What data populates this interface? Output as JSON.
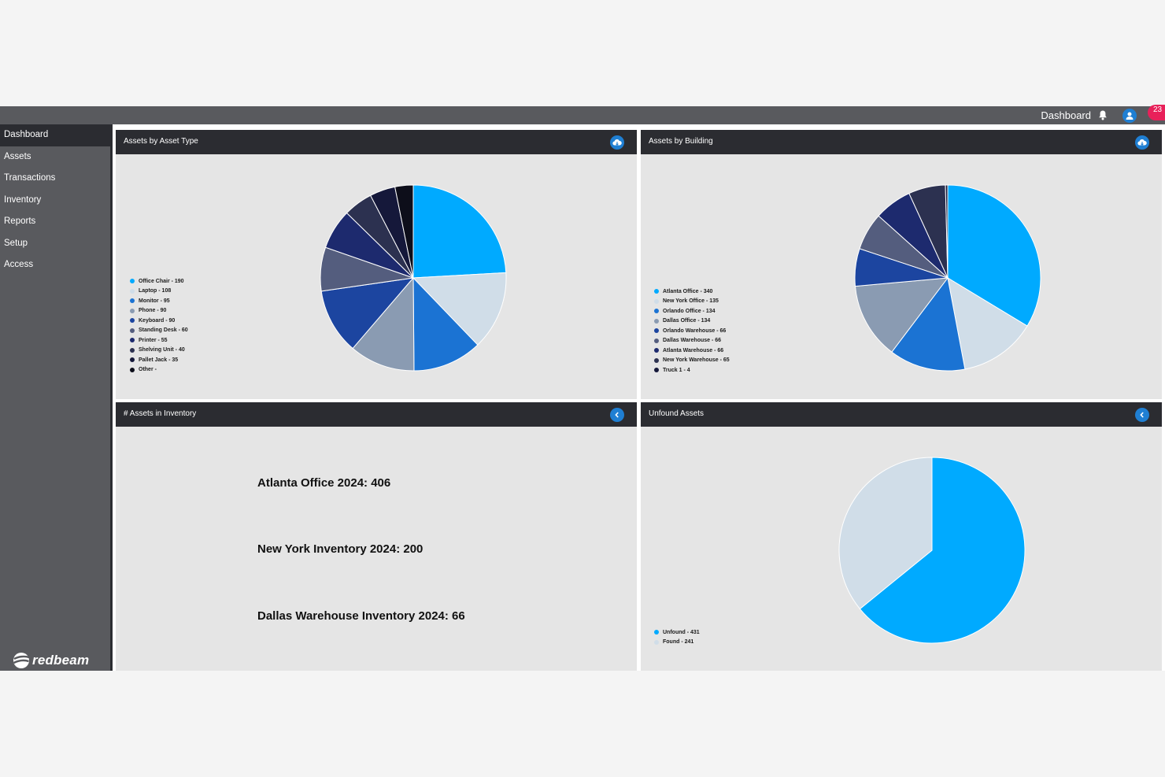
{
  "topbar": {
    "title": "Dashboard",
    "notification_count": "23"
  },
  "sidebar": {
    "items": [
      {
        "label": "Dashboard"
      },
      {
        "label": "Assets"
      },
      {
        "label": "Transactions"
      },
      {
        "label": "Inventory"
      },
      {
        "label": "Reports"
      },
      {
        "label": "Setup"
      },
      {
        "label": "Access"
      }
    ],
    "active": "Dashboard",
    "logo_text": "redbeam"
  },
  "panels": {
    "asset_type": {
      "title": "Assets by Asset Type",
      "button_icon": "cloud-download-icon"
    },
    "building": {
      "title": "Assets by Building",
      "button_icon": "cloud-download-icon"
    },
    "inventory": {
      "title": "# Assets in Inventory",
      "button_icon": "chevron-left-icon",
      "lines": [
        "Atlanta Office 2024: 406",
        "New York Inventory 2024: 200",
        "Dallas Warehouse Inventory 2024: 66"
      ]
    },
    "unfound": {
      "title": "Unfound Assets",
      "button_icon": "chevron-left-icon"
    }
  },
  "chart_data": [
    {
      "type": "pie",
      "legend_placement": "left",
      "labels": [
        "Office Chair - 190",
        "Laptop - 108",
        "Monitor - 95",
        "Phone - 90",
        "Keyboard - 90",
        "Standing Desk - 60",
        "Printer - 55",
        "Shelving Unit - 40",
        "Pallet Jack - 35",
        "Other -"
      ],
      "categories": [
        "Office Chair",
        "Laptop",
        "Monitor",
        "Phone",
        "Keyboard",
        "Standing Desk",
        "Printer",
        "Shelving Unit",
        "Pallet Jack",
        "Other"
      ],
      "values": [
        190,
        108,
        95,
        90,
        90,
        60,
        55,
        40,
        35,
        25
      ],
      "colors": [
        "#00aaff",
        "#d0dde8",
        "#1b73d3",
        "#8a9bb2",
        "#1c45a0",
        "#545d7e",
        "#1d2a6e",
        "#2c3150",
        "#15183a",
        "#0d0e1a"
      ]
    },
    {
      "type": "pie",
      "legend_placement": "left",
      "labels": [
        "Atlanta Office - 340",
        "New York Office - 135",
        "Orlando Office - 134",
        "Dallas Office - 134",
        "Orlando Warehouse - 66",
        "Dallas Warehouse - 66",
        "Atlanta Warehouse - 66",
        "New York Warehouse - 65",
        "Truck 1 - 4"
      ],
      "categories": [
        "Atlanta Office",
        "New York Office",
        "Orlando Office",
        "Dallas Office",
        "Orlando Warehouse",
        "Dallas Warehouse",
        "Atlanta Warehouse",
        "New York Warehouse",
        "Truck 1"
      ],
      "values": [
        340,
        135,
        134,
        134,
        66,
        66,
        66,
        65,
        4
      ],
      "colors": [
        "#00aaff",
        "#d0dde8",
        "#1b73d3",
        "#8a9bb2",
        "#1c45a0",
        "#545d7e",
        "#1d2a6e",
        "#2c3150",
        "#15183a"
      ]
    },
    {
      "type": "pie",
      "legend_placement": "bottom-left",
      "labels": [
        "Unfound - 431",
        "Found - 241"
      ],
      "categories": [
        "Unfound",
        "Found"
      ],
      "values": [
        431,
        241
      ],
      "colors": [
        "#00aaff",
        "#d0dde8"
      ]
    }
  ]
}
